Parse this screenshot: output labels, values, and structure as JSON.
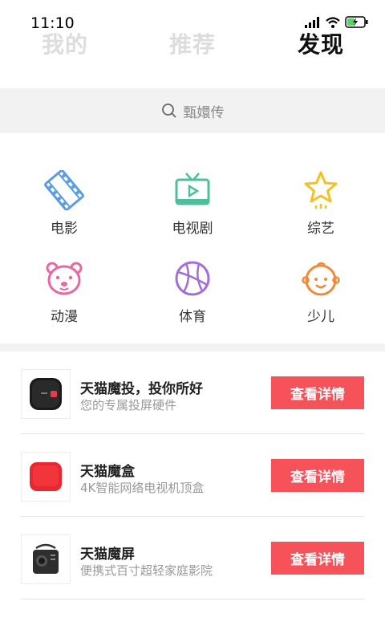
{
  "status": {
    "time": "11:10"
  },
  "tabs": {
    "mine": "我的",
    "recommend": "推荐",
    "discover": "发现"
  },
  "search": {
    "placeholder": "甄嬛传",
    "icon": "search-icon"
  },
  "categories": [
    {
      "label": "电影",
      "icon": "film-icon",
      "color": "#5b9de0"
    },
    {
      "label": "电视剧",
      "icon": "tv-icon",
      "color": "#4cbf9b"
    },
    {
      "label": "综艺",
      "icon": "star-icon",
      "color": "#f2c21f"
    },
    {
      "label": "动漫",
      "icon": "bear-icon",
      "color": "#e868a0"
    },
    {
      "label": "体育",
      "icon": "basketball-icon",
      "color": "#a26fd6"
    },
    {
      "label": "少儿",
      "icon": "child-face-icon",
      "color": "#f28a3a"
    }
  ],
  "products": [
    {
      "title": "天猫魔投，投你所好",
      "subtitle": "您的专属投屏硬件",
      "button": "查看详情"
    },
    {
      "title": "天猫魔盒",
      "subtitle": "4K智能网络电视机顶盒",
      "button": "查看详情"
    },
    {
      "title": "天猫魔屏",
      "subtitle": "便携式百寸超轻家庭影院",
      "button": "查看详情"
    }
  ],
  "colors": {
    "accent": "#f5525a",
    "band": "#f2f2f2"
  }
}
